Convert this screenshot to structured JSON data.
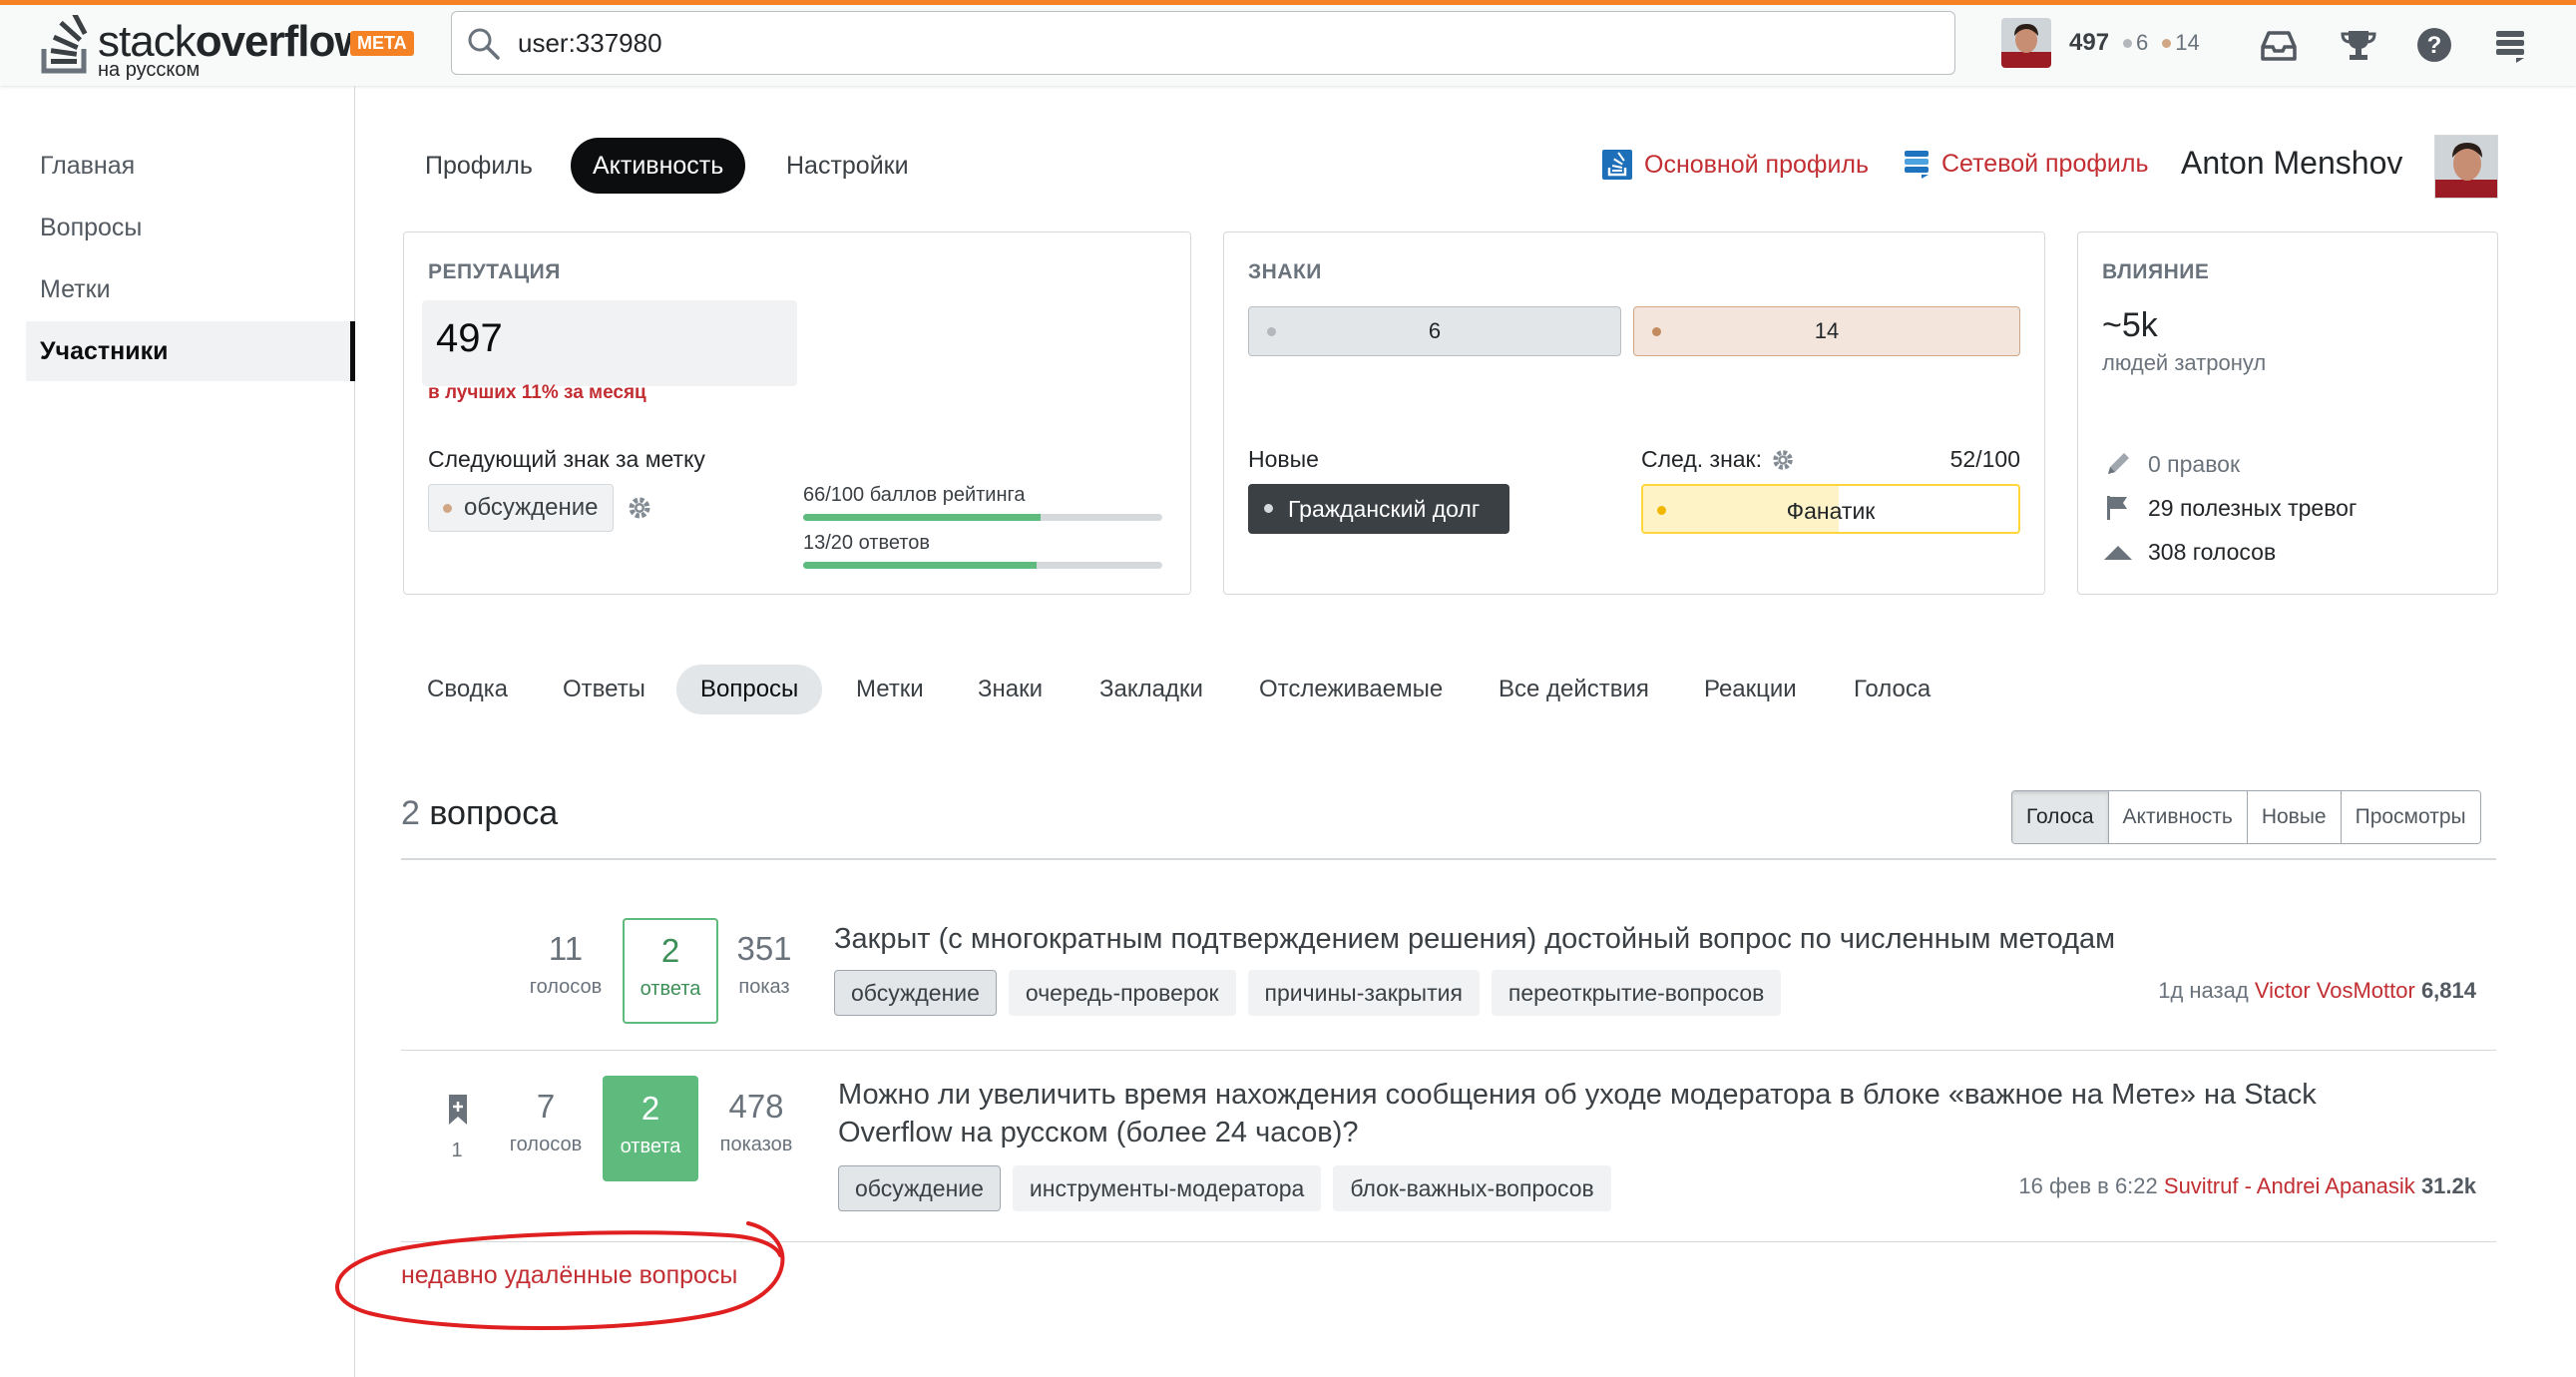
{
  "header": {
    "logo_word_light": "stack",
    "logo_word_bold": "overflow",
    "logo_sub": "на русском",
    "meta_badge": "META",
    "search_value": "user:337980",
    "reputation": "497",
    "silver_count": "6",
    "bronze_count": "14",
    "colors": {
      "accent": "#f48225",
      "silver": "#b4b8bc",
      "bronze": "#d1a684"
    }
  },
  "leftnav": {
    "items": [
      {
        "label": "Главная"
      },
      {
        "label": "Вопросы"
      },
      {
        "label": "Метки"
      },
      {
        "label": "Участники",
        "active": true
      }
    ]
  },
  "profile": {
    "tabs": [
      {
        "label": "Профиль"
      },
      {
        "label": "Активность",
        "active": true
      },
      {
        "label": "Настройки"
      }
    ],
    "main_profile_link": "Основной профиль",
    "network_profile_link": "Сетевой профиль",
    "user_name": "Anton Menshov"
  },
  "reputation_card": {
    "title": "РЕПУТАЦИЯ",
    "value": "497",
    "note": "в лучших 11% за месяц",
    "next_badge_label": "Следующий знак за метку",
    "tag": "обсуждение",
    "progress": [
      {
        "label": "66/100 баллов рейтинга",
        "fraction": 0.66
      },
      {
        "label": "13/20 ответов",
        "fraction": 0.65
      }
    ]
  },
  "badges_card": {
    "title": "ЗНАКИ",
    "silver": "6",
    "bronze": "14",
    "new_label": "Новые",
    "new_badge": "Гражданский долг",
    "next_label": "След. знак:",
    "next_progress": "52/100",
    "next_badge": "Фанатик",
    "next_fraction": 0.52
  },
  "impact_card": {
    "title": "ВЛИЯНИЕ",
    "value": "~5k",
    "subtitle": "людей затронул",
    "rows": [
      {
        "icon": "pencil-icon",
        "text": "0 правок",
        "muted": true
      },
      {
        "icon": "flag-icon",
        "text": "29 полезных тревог"
      },
      {
        "icon": "upvote-icon",
        "text": "308 голосов"
      }
    ]
  },
  "activity_tabs": [
    {
      "label": "Сводка"
    },
    {
      "label": "Ответы"
    },
    {
      "label": "Вопросы",
      "active": true
    },
    {
      "label": "Метки"
    },
    {
      "label": "Знаки"
    },
    {
      "label": "Закладки"
    },
    {
      "label": "Отслеживаемые"
    },
    {
      "label": "Все действия"
    },
    {
      "label": "Реакции"
    },
    {
      "label": "Голоса"
    }
  ],
  "questions": {
    "count_num": "2",
    "count_label": "вопроса",
    "sort_options": [
      {
        "label": "Голоса",
        "active": true
      },
      {
        "label": "Активность"
      },
      {
        "label": "Новые"
      },
      {
        "label": "Просмотры"
      }
    ],
    "items": [
      {
        "votes": "11",
        "votes_label": "голосов",
        "answers": "2",
        "answers_label": "ответа",
        "views": "351",
        "views_label": "показ",
        "title": "Закрыт (с многократным подтверждением решения) достойный вопрос по численным методам",
        "tags": [
          "обсуждение",
          "очередь-проверок",
          "причины-закрытия",
          "переоткрытие-вопросов"
        ],
        "time": "1д назад",
        "author": "Victor VosMottor",
        "author_rep": "6,814"
      },
      {
        "bookmarks": "1",
        "votes": "7",
        "votes_label": "голосов",
        "answers": "2",
        "answers_label": "ответа",
        "views": "478",
        "views_label": "показов",
        "title_line1": "Можно ли увеличить время нахождения сообщения об уходе модератора в блоке «важное на Мете» на Stack",
        "title_line2": "Overflow на русском (более 24 часов)?",
        "tags": [
          "обсуждение",
          "инструменты-модератора",
          "блок-важных-вопросов"
        ],
        "time": "16 фев в 6:22",
        "author": "Suvitruf - Andrei Apanasik",
        "author_rep": "31.2k"
      }
    ],
    "deleted_link": "недавно удалённые вопросы"
  }
}
